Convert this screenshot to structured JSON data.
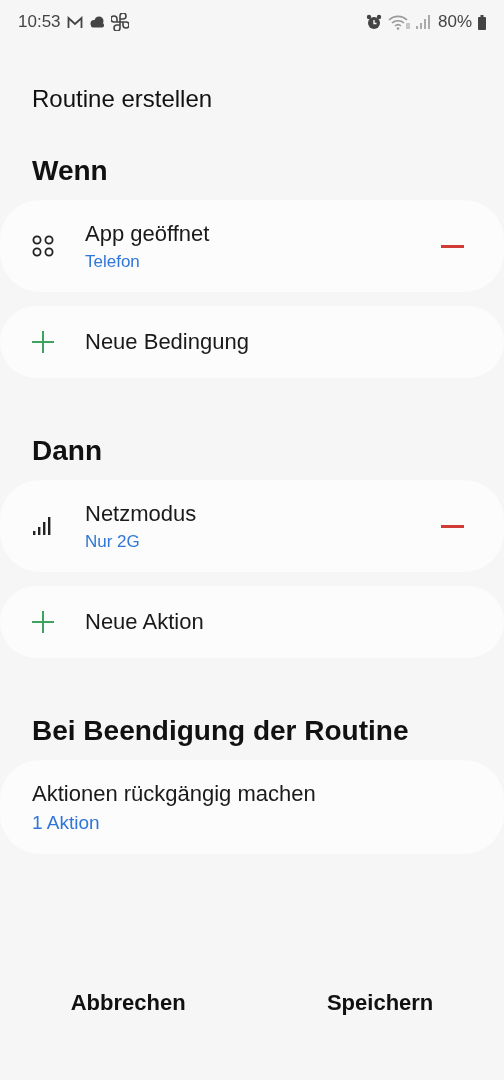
{
  "status_bar": {
    "time": "10:53",
    "battery": "80%"
  },
  "title": "Routine erstellen",
  "sections": [
    {
      "title": "Wenn",
      "items": [
        {
          "kind": "app",
          "title": "App geöffnet",
          "subtitle": "Telefon",
          "removable": true
        },
        {
          "kind": "add",
          "title": "Neue Bedingung"
        }
      ]
    },
    {
      "title": "Dann",
      "items": [
        {
          "kind": "network",
          "title": "Netzmodus",
          "subtitle": "Nur 2G",
          "removable": true
        },
        {
          "kind": "add",
          "title": "Neue Aktion"
        }
      ]
    },
    {
      "title": "Bei Beendigung der Routine",
      "items": [
        {
          "kind": "plain",
          "title": "Aktionen rückgängig machen",
          "subtitle": "1 Aktion"
        }
      ]
    }
  ],
  "buttons": [
    "Abbrechen",
    "Speichern"
  ]
}
